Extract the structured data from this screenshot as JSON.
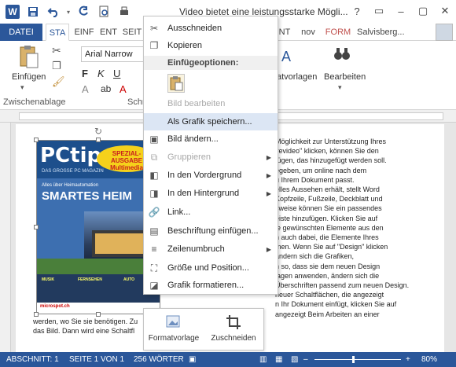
{
  "title_bar": {
    "app_icon": "word-logo",
    "document_title": "Video bietet eine leistungsstarke Mögli...",
    "undo_icon": "undo-icon",
    "redo_icon": "redo-icon",
    "save_icon": "save-icon",
    "controls": [
      "?",
      "▭",
      "–",
      "▢",
      "✕"
    ]
  },
  "tabs": {
    "file": "DATEI",
    "items": [
      {
        "label": "STA",
        "active": true
      },
      {
        "label": "EINF",
        "active": false
      },
      {
        "label": "ENT",
        "active": false
      },
      {
        "label": "SEIT",
        "active": false
      },
      {
        "label": "NT",
        "active": false
      },
      {
        "label": "nov",
        "active": false
      },
      {
        "label": "FORM",
        "active": false
      }
    ],
    "user": "Salvisberg..."
  },
  "ribbon": {
    "paste_label": "Einfügen",
    "clipboard_group": "Zwischenablage",
    "font_group_prefix": "Schr",
    "font_name": "Arial Narrow",
    "styles_label": "Formatvorlagen",
    "styles_prefix": "atvorlagen",
    "edit_label": "Bearbeiten"
  },
  "context_menu": {
    "items": [
      {
        "label": "Ausschneiden",
        "icon": "scissors-icon",
        "disabled": false,
        "submenu": false
      },
      {
        "label": "Kopieren",
        "icon": "copy-icon",
        "disabled": false,
        "submenu": false
      },
      {
        "label": "Bild bearbeiten",
        "icon": "",
        "disabled": true,
        "submenu": false
      },
      {
        "label": "Als Grafik speichern...",
        "icon": "",
        "disabled": false,
        "submenu": false,
        "highlight": true
      },
      {
        "label": "Bild ändern...",
        "icon": "change-picture-icon",
        "disabled": false,
        "submenu": false
      },
      {
        "label": "Gruppieren",
        "icon": "group-icon",
        "disabled": true,
        "submenu": true
      },
      {
        "label": "In den Vordergrund",
        "icon": "bring-forward-icon",
        "disabled": false,
        "submenu": true
      },
      {
        "label": "In den Hintergrund",
        "icon": "send-backward-icon",
        "disabled": false,
        "submenu": true
      },
      {
        "label": "Link...",
        "icon": "link-icon",
        "disabled": false,
        "submenu": false
      },
      {
        "label": "Beschriftung einfügen...",
        "icon": "caption-icon",
        "disabled": false,
        "submenu": false
      },
      {
        "label": "Zeilenumbruch",
        "icon": "wrap-text-icon",
        "disabled": false,
        "submenu": true
      },
      {
        "label": "Größe und Position...",
        "icon": "size-position-icon",
        "disabled": false,
        "submenu": false
      },
      {
        "label": "Grafik formatieren...",
        "icon": "format-picture-icon",
        "disabled": false,
        "submenu": false
      }
    ],
    "paste_options_header": "Einfügeoptionen:"
  },
  "mini_toolbar": {
    "style_label": "Formatvorlage",
    "crop_label": "Zuschneiden"
  },
  "document": {
    "magazine": {
      "brand": "PCtipp",
      "tagline": "DAS GROSSE PC MAGAZIN",
      "badge": "SPEZIAL-AUSGABE Multimedia",
      "kicker": "Alles über Heimautomation",
      "headline": "SMARTES HEIM",
      "footer_cols": [
        "MUSIK",
        "FERNSEHEN",
        "AUTO"
      ],
      "barcode_label": "microspot.ch"
    },
    "right_lines": [
      "Möglichkeit zur Unterstützung Ihres",
      "vevideo\" klicken, können Sie den",
      "fügen, das hinzugefügt werden soll.",
      "egeben, um online nach dem",
      "u Ihrem Dokument passt.",
      "elles Aussehen erhält, stellt Word",
      "Kopfzeile, Fußzeile, Deckblatt und",
      "sweise können Sie ein passendes",
      "eiste hinzufügen. Klicken Sie auf",
      "ie gewünschten Elemente aus den",
      "",
      "n auch dabei, die Elemente Ihres",
      "men. Wenn Sie auf \"Design\" klicken",
      "ändern sich die Grafiken,",
      "n so, dass sie dem neuen Design",
      "lagen anwenden, ändern sich die",
      "Überschriften passend zum neuen Design.",
      "neuer Schaltflächen, die angezeigt",
      "n Ihr Dokument einfügt, klicken Sie auf",
      "angezeigt Beim Arbeiten an einer"
    ],
    "bottom_lines": [
      "werden, wo Sie sie benötigen. Zu",
      "das Bild. Dann wird eine Schaltfl"
    ]
  },
  "status_bar": {
    "section": "ABSCHNITT: 1",
    "page": "SEITE 1 VON 1",
    "words": "256 WÖRTER",
    "zoom": "80%"
  },
  "colors": {
    "accent": "#2b579a",
    "menu_highlight": "#dce6f4"
  }
}
